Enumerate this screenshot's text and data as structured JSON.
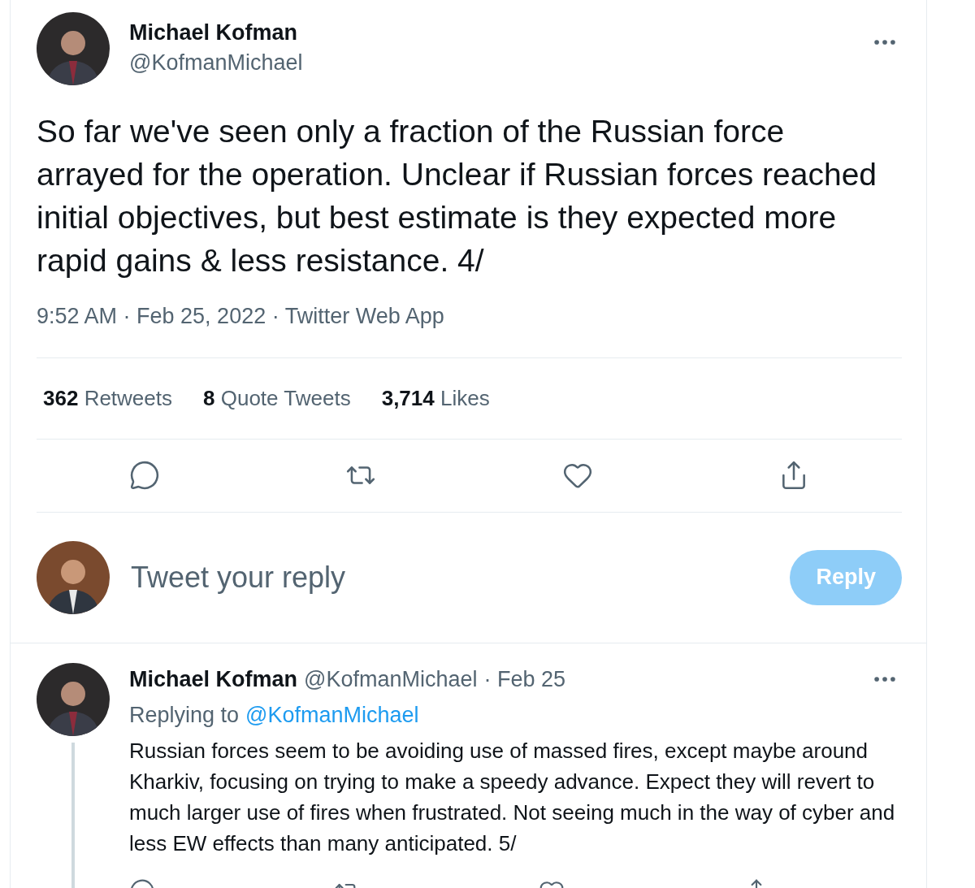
{
  "tweet": {
    "name": "Michael Kofman",
    "handle": "@KofmanMichael",
    "text": "So far we've seen only a fraction of the Russian force arrayed for the operation. Unclear if Russian forces reached initial objectives, but best estimate is they expected more rapid gains & less resistance. 4/",
    "meta": "9:52 AM · Feb 25, 2022 · Twitter Web App",
    "stats": [
      {
        "count": "362",
        "label": "Retweets"
      },
      {
        "count": "8",
        "label": "Quote Tweets"
      },
      {
        "count": "3,714",
        "label": "Likes"
      }
    ]
  },
  "composer": {
    "placeholder": "Tweet your reply",
    "button": {
      "label": "Reply",
      "disabled": true
    }
  },
  "reply": {
    "name": "Michael Kofman",
    "handle": "@KofmanMichael",
    "date": "· Feb 25",
    "replying_prefix": "Replying to",
    "replying_to": "@KofmanMichael",
    "text": "Russian forces seem to be avoiding use of massed fires, except maybe around Kharkiv, focusing on trying to make a speedy advance. Expect they will revert to much larger use of fires when frustrated. Not seeing much in the way of cyber and less EW effects than many anticipated. 5/"
  }
}
